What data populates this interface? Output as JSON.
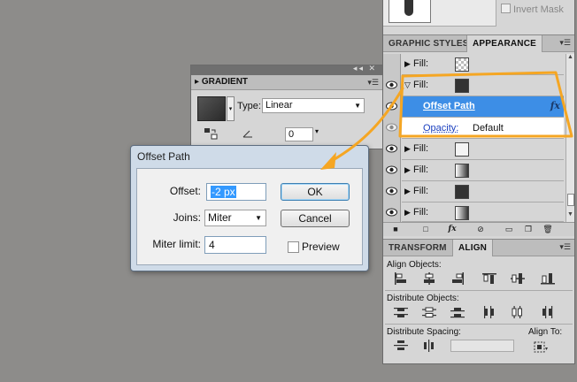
{
  "top": {
    "invert_mask_label": "Invert Mask"
  },
  "tabs": {
    "graphic_styles": "GRAPHIC STYLES",
    "appearance": "APPEARANCE",
    "transform": "TRANSFORM",
    "align": "ALIGN"
  },
  "appearance": {
    "fill_label": "Fill:",
    "effect_name": "Offset Path",
    "opacity_label": "Opacity:",
    "opacity_value": "Default"
  },
  "gradient_panel": {
    "title": "GRADIENT",
    "type_label": "Type:",
    "type_value": "Linear",
    "angle_value": "0"
  },
  "dialog": {
    "title": "Offset Path",
    "offset_label": "Offset:",
    "offset_value": "-2 px",
    "joins_label": "Joins:",
    "joins_value": "Miter",
    "miter_label": "Miter limit:",
    "miter_value": "4",
    "ok_label": "OK",
    "cancel_label": "Cancel",
    "preview_label": "Preview"
  },
  "align_panel": {
    "align_objects": "Align Objects:",
    "distribute_objects": "Distribute Objects:",
    "distribute_spacing": "Distribute Spacing:",
    "align_to": "Align To:"
  },
  "colors": {
    "selection_blue": "#3d8ee6",
    "annotation_orange": "#f5a623"
  }
}
